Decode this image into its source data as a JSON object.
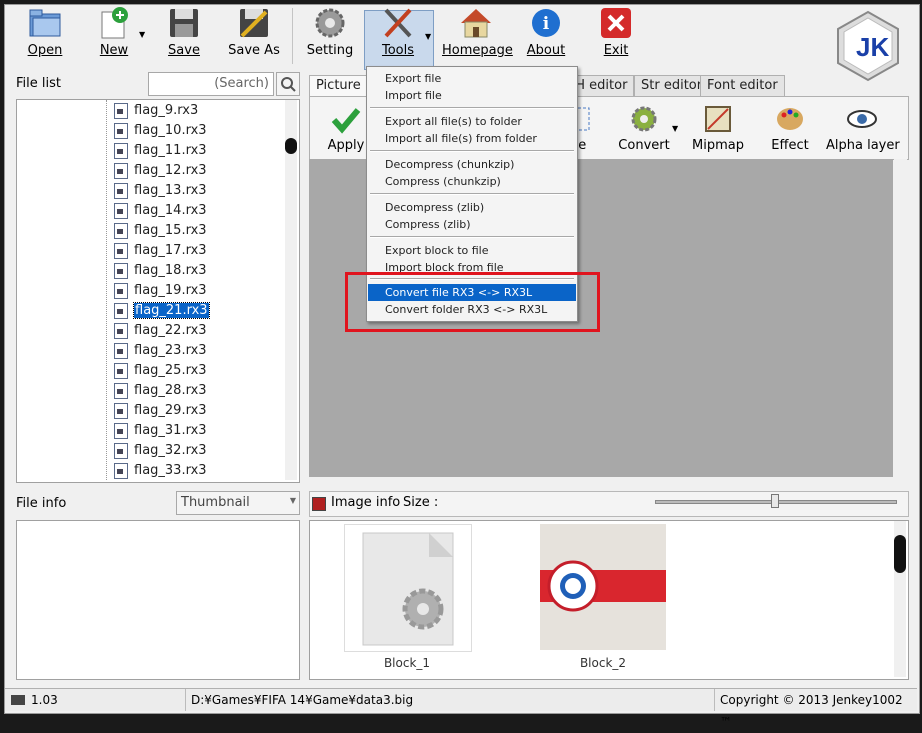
{
  "toolbar": {
    "open": "Open",
    "new": "New",
    "save": "Save",
    "save_as": "Save As",
    "setting": "Setting",
    "tools": "Tools",
    "homepage": "Homepage",
    "about": "About",
    "exit": "Exit",
    "logo": "JK"
  },
  "file_list": {
    "label": "File list",
    "search_placeholder": "(Search)",
    "items": [
      "flag_9.rx3",
      "flag_10.rx3",
      "flag_11.rx3",
      "flag_12.rx3",
      "flag_13.rx3",
      "flag_14.rx3",
      "flag_15.rx3",
      "flag_17.rx3",
      "flag_18.rx3",
      "flag_19.rx3",
      "flag_21.rx3",
      "flag_22.rx3",
      "flag_23.rx3",
      "flag_25.rx3",
      "flag_28.rx3",
      "flag_29.rx3",
      "flag_31.rx3",
      "flag_32.rx3",
      "flag_33.rx3"
    ],
    "selected": "flag_21.rx3"
  },
  "tabs": [
    "Picture",
    "SH editor",
    "Str editor",
    "Font editor"
  ],
  "picture_toolbar": {
    "apply": "Apply",
    "size": "ize",
    "convert": "Convert",
    "mipmap": "Mipmap",
    "effect": "Effect",
    "alpha_layer": "Alpha layer"
  },
  "tools_menu": {
    "export_file": "Export file",
    "import_file": "Import file",
    "export_all": "Export all file(s) to folder",
    "import_all": "Import all file(s) from folder",
    "decompress_chunkzip": "Decompress (chunkzip)",
    "compress_chunkzip": "Compress (chunkzip)",
    "decompress_zlib": "Decompress (zlib)",
    "compress_zlib": "Compress (zlib)",
    "export_block": "Export block to file",
    "import_block": "Import block from file",
    "convert_file": "Convert file RX3 <-> RX3L",
    "convert_folder": "Convert folder RX3 <-> RX3L"
  },
  "file_info": {
    "label": "File info",
    "view_mode": "Thumbnail"
  },
  "image_info": {
    "label": "Image info",
    "size_label": "Size :"
  },
  "blocks": [
    "Block_1",
    "Block_2"
  ],
  "status": {
    "version": "1.03",
    "path": "D:¥Games¥FIFA 14¥Game¥data3.big",
    "copyright": "Copyright © 2013 Jenkey1002 ™"
  },
  "colors": {
    "selection": "#0a64c8",
    "highlight_box": "#e0141e",
    "canvas_gray": "#a8a8a8",
    "flag_red": "#d9262e"
  }
}
